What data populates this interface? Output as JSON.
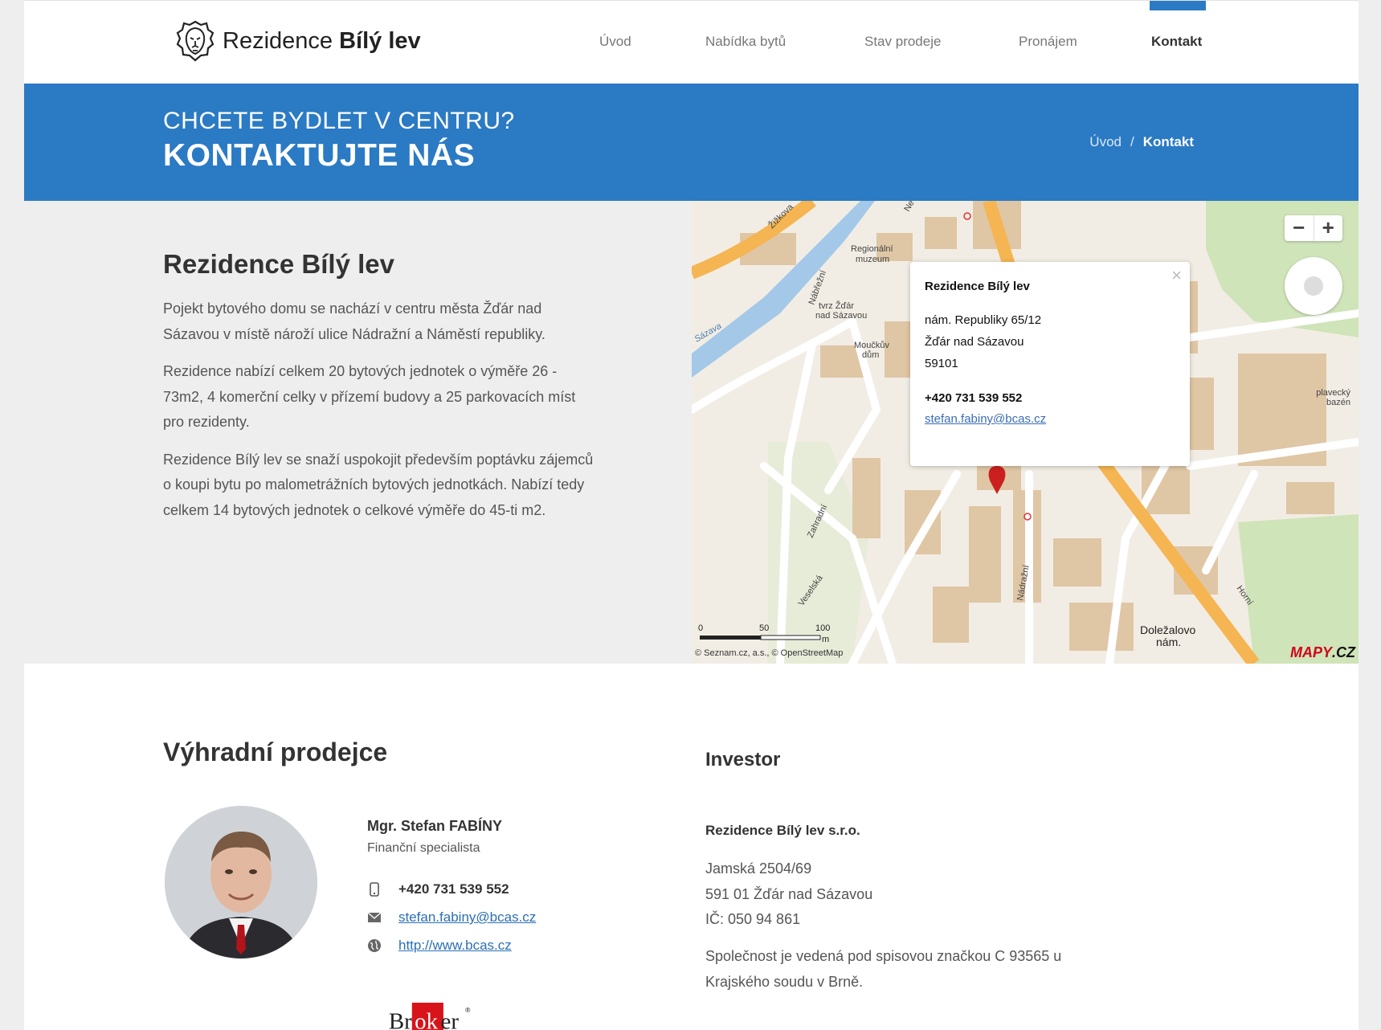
{
  "brand": {
    "name_light": "Rezidence",
    "name_bold": "Bílý lev"
  },
  "nav": {
    "items": [
      {
        "label": "Úvod"
      },
      {
        "label": "Nabídka bytů"
      },
      {
        "label": "Stav prodeje"
      },
      {
        "label": "Pronájem"
      },
      {
        "label": "Kontakt"
      }
    ],
    "active": "Kontakt"
  },
  "banner": {
    "subtitle": "CHCETE BYDLET V CENTRU?",
    "title": "KONTAKTUJTE NÁS",
    "breadcrumb": {
      "home": "Úvod",
      "separator": "/",
      "current": "Kontakt"
    }
  },
  "intro": {
    "heading": "Rezidence Bílý lev",
    "paragraphs": [
      "Pojekt bytového domu  se nachází v centru města Žďár nad Sázavou v místě nároží ulice Nádražní a Náměstí republiky.",
      "Rezidence nabízí celkem 20 bytových jednotek o výměře 26 - 73m2, 4 komerční celky v přízemí budovy a 25 parkovacích míst pro rezidenty.",
      "Rezidence Bílý lev se snaží uspokojit především poptávku zájemců o koupi bytu po malometrážních bytových jednotkách. Nabízí tedy celkem 14 bytových jednotek o celkové výměře do 45-ti m2."
    ]
  },
  "map": {
    "popup": {
      "title": "Rezidence Bílý lev",
      "address_lines": [
        "nám. Republiky 65/12",
        "Žďár nad Sázavou",
        "59101"
      ],
      "phone": "+420 731 539 552",
      "email": "stefan.fabiny@bcas.cz",
      "close": "×"
    },
    "zoom_out": "−",
    "zoom_in": "+",
    "labels": {
      "zizkova": "Žižkova",
      "sazava": "Sázava",
      "nabrezni": "Nábřežní",
      "regionalni": "Regionální",
      "muzeum": "muzeum",
      "tvrz1": "tvrz Žďár",
      "tvrz2": "nad Sázavou",
      "mouckuv1": "Moučkův",
      "mouckuv2": "dům",
      "zahradni": "Zahradní",
      "veselska": "Veselská",
      "nadrazni": "Nádražní",
      "horni": "Horní",
      "dolezalovo1": "Doležalovo",
      "dolezalovo2": "nám.",
      "plavecky1": "plavecký",
      "plavecky2": "bazén",
      "ne": "Ne"
    },
    "scale": {
      "zero": "0",
      "mid": "50",
      "max": "100",
      "unit": "m"
    },
    "copyright": "© Seznam.cz, a.s., © OpenStreetMap",
    "logo_a": "MAPY",
    "logo_b": ".CZ"
  },
  "seller": {
    "heading": "Výhradní prodejce",
    "name": "Mgr. Stefan FABÍNY",
    "role": "Finanční specialista",
    "phone": "+420 731 539 552",
    "email": "stefan.fabiny@bcas.cz",
    "web": "http://www.bcas.cz",
    "broker_logo_a": "Br",
    "broker_logo_b": "ok",
    "broker_logo_c": "er",
    "broker_logo_reg": "®"
  },
  "investor": {
    "heading": "Investor",
    "company": "Rezidence Bílý lev s.r.o.",
    "address_lines": [
      "Jamská 2504/69",
      "591 01 Žďár nad Sázavou",
      "IČ: 050 94 861"
    ],
    "note": "Společnost je vedená pod spisovou značkou C 93565 u Krajského soudu v Brně."
  },
  "colors": {
    "accent": "#2b7ac4",
    "link": "#2b6fb5",
    "map_road": "#f4b552",
    "map_water": "#a4c8e8",
    "map_park": "#cfe4b9",
    "map_building": "#dfc6a5"
  }
}
